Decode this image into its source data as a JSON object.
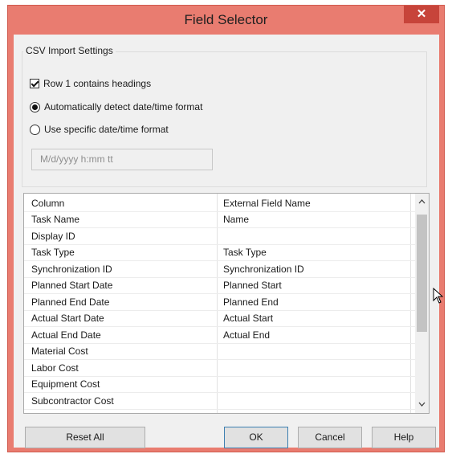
{
  "window": {
    "title": "Field Selector",
    "close_glyph": "✕"
  },
  "csv_settings": {
    "legend": "CSV Import Settings",
    "row1_headings": {
      "label": "Row 1 contains headings",
      "checked": true
    },
    "auto_detect": {
      "label": "Automatically detect date/time format",
      "selected": true
    },
    "specific_format": {
      "label": "Use specific date/time format",
      "selected": false
    },
    "format_placeholder": "M/d/yyyy h:mm tt"
  },
  "grid": {
    "headers": {
      "column": "Column",
      "external": "External Field Name"
    },
    "rows": [
      {
        "column": "Task Name",
        "external": "Name"
      },
      {
        "column": "Display ID",
        "external": ""
      },
      {
        "column": "Task Type",
        "external": "Task Type"
      },
      {
        "column": "Synchronization ID",
        "external": "Synchronization ID"
      },
      {
        "column": "Planned Start Date",
        "external": "Planned Start"
      },
      {
        "column": "Planned End Date",
        "external": "Planned End"
      },
      {
        "column": "Actual Start Date",
        "external": "Actual Start"
      },
      {
        "column": "Actual End Date",
        "external": "Actual End"
      },
      {
        "column": "Material Cost",
        "external": ""
      },
      {
        "column": "Labor Cost",
        "external": ""
      },
      {
        "column": "Equipment Cost",
        "external": ""
      },
      {
        "column": "Subcontractor Cost",
        "external": ""
      }
    ],
    "scroll_up_icon": "chevron-up-icon",
    "scroll_down_icon": "chevron-down-icon"
  },
  "buttons": {
    "reset_all": "Reset All",
    "ok": "OK",
    "cancel": "Cancel",
    "help": "Help"
  },
  "colors": {
    "title_bar": "#e97c70",
    "close_button": "#c7443a",
    "dialog_bg": "#f0f0f0"
  }
}
